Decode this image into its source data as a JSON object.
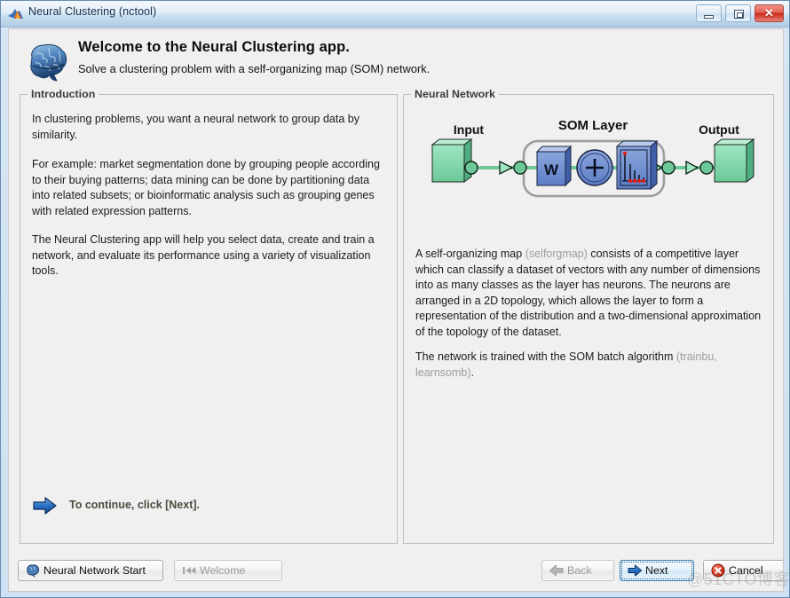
{
  "window": {
    "title": "Neural Clustering (nctool)",
    "logo_icon": "matlab-membrane-icon",
    "minimize_label": "–",
    "maximize_label": "□",
    "close_label": "✕"
  },
  "header": {
    "icon": "brain-icon",
    "title": "Welcome to the Neural Clustering app.",
    "subtitle": "Solve a clustering problem with a self-organizing map (SOM) network."
  },
  "introduction": {
    "legend": "Introduction",
    "paragraphs": [
      "In clustering problems, you want a neural network to group data by similarity.",
      "For example: market segmentation done by grouping people according to their buying patterns; data mining can be done by partitioning data into related subsets; or bioinformatic analysis such as grouping genes with related expression patterns.",
      "The Neural Clustering app will help you select data, create and train a network, and evaluate its performance using a variety of visualization tools."
    ]
  },
  "neural_network": {
    "legend": "Neural Network",
    "diagram": {
      "input_label": "Input",
      "layer_label": "SOM Layer",
      "output_label": "Output",
      "weight_block_label": "W",
      "sum_block_label": "+",
      "transfer_function_icon": "compet-transfer-function-icon",
      "block_color": "#7fd7a8",
      "box_color": "#6f8fd0",
      "line_color": "#5fc79a"
    },
    "description_1_before": "A self-organizing map ",
    "description_1_fn": "(selforgmap)",
    "description_1_after": " consists of a competitive layer which can classify a dataset of vectors with any number of dimensions into as many classes as the layer has neurons. The neurons are arranged in a 2D topology, which allows the layer to form a representation of the distribution and a two-dimensional approximation of the topology of the dataset.",
    "description_2_before": "The network is trained with the SOM batch algorithm ",
    "description_2_fn": "(trainbu, learnsomb)",
    "description_2_after": "."
  },
  "footer": {
    "hint_icon": "right-arrow-icon",
    "hint_text": "To continue, click [Next].",
    "buttons": {
      "neural_network_start": {
        "label": "Neural Network Start",
        "icon": "brain-icon",
        "enabled": true
      },
      "welcome": {
        "label": "Welcome",
        "icon": "rewind-icon",
        "enabled": false
      },
      "back": {
        "label": "Back",
        "icon": "left-arrow-icon",
        "enabled": false
      },
      "next": {
        "label": "Next",
        "icon": "right-arrow-icon",
        "enabled": true,
        "focused": true
      },
      "cancel": {
        "label": "Cancel",
        "icon": "error-x-icon",
        "enabled": true
      }
    }
  },
  "watermark": {
    "text": "@51CTO博客"
  }
}
